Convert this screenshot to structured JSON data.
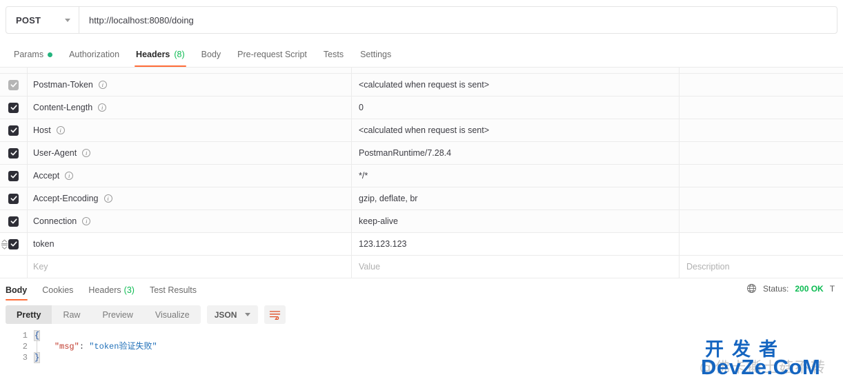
{
  "request": {
    "method": "POST",
    "url": "http://localhost:8080/doing",
    "tabs": [
      {
        "label": "Params",
        "dot": true,
        "count": ""
      },
      {
        "label": "Authorization",
        "dot": false,
        "count": ""
      },
      {
        "label": "Headers",
        "dot": false,
        "count": "(8)"
      },
      {
        "label": "Body",
        "dot": false,
        "count": ""
      },
      {
        "label": "Pre-request Script",
        "dot": false,
        "count": ""
      },
      {
        "label": "Tests",
        "dot": false,
        "count": ""
      },
      {
        "label": "Settings",
        "dot": false,
        "count": ""
      }
    ],
    "active_tab": "Headers"
  },
  "headers_table": {
    "placeholders": {
      "key": "Key",
      "value": "Value",
      "description": "Description"
    },
    "rows": [
      {
        "checked": true,
        "disabled": true,
        "key": "Postman-Token",
        "info": true,
        "drag": false,
        "value": "<calculated when request is sent>",
        "description": ""
      },
      {
        "checked": true,
        "disabled": false,
        "key": "Content-Length",
        "info": true,
        "drag": false,
        "value": "0",
        "description": ""
      },
      {
        "checked": true,
        "disabled": false,
        "key": "Host",
        "info": true,
        "drag": false,
        "value": "<calculated when request is sent>",
        "description": ""
      },
      {
        "checked": true,
        "disabled": false,
        "key": "User-Agent",
        "info": true,
        "drag": false,
        "value": "PostmanRuntime/7.28.4",
        "description": ""
      },
      {
        "checked": true,
        "disabled": false,
        "key": "Accept",
        "info": true,
        "drag": false,
        "value": "*/*",
        "description": ""
      },
      {
        "checked": true,
        "disabled": false,
        "key": "Accept-Encoding",
        "info": true,
        "drag": false,
        "value": "gzip, deflate, br",
        "description": ""
      },
      {
        "checked": true,
        "disabled": false,
        "key": "Connection",
        "info": true,
        "drag": false,
        "value": "keep-alive",
        "description": ""
      },
      {
        "checked": true,
        "disabled": false,
        "key": "token",
        "info": false,
        "drag": true,
        "value": "123.123.123",
        "description": ""
      }
    ]
  },
  "response": {
    "tabs": [
      {
        "label": "Body",
        "count": ""
      },
      {
        "label": "Cookies",
        "count": ""
      },
      {
        "label": "Headers",
        "count": "(3)"
      },
      {
        "label": "Test Results",
        "count": ""
      }
    ],
    "active_tab": "Body",
    "status_prefix": "Status:",
    "status_value": "200 OK",
    "time_clipped": "T",
    "view_modes": [
      "Pretty",
      "Raw",
      "Preview",
      "Visualize"
    ],
    "active_view": "Pretty",
    "language": "JSON",
    "body_lines": [
      {
        "n": "1",
        "type": "brace",
        "text": "{"
      },
      {
        "n": "2",
        "type": "pair",
        "key": "\"msg\"",
        "sep": ": ",
        "value": "\"token验证失败\""
      },
      {
        "n": "3",
        "type": "brace",
        "text": "}"
      }
    ]
  },
  "watermark": {
    "chinese": "开发者",
    "latin": "DevZe.CoM",
    "ghost": "@佛卡撕土菇不转"
  },
  "colors": {
    "accent": "#ff6c37",
    "success": "#0cbb52",
    "text": "#3c3c43",
    "muted": "#8a8a8a",
    "watermark_blue": "#1565c0"
  }
}
